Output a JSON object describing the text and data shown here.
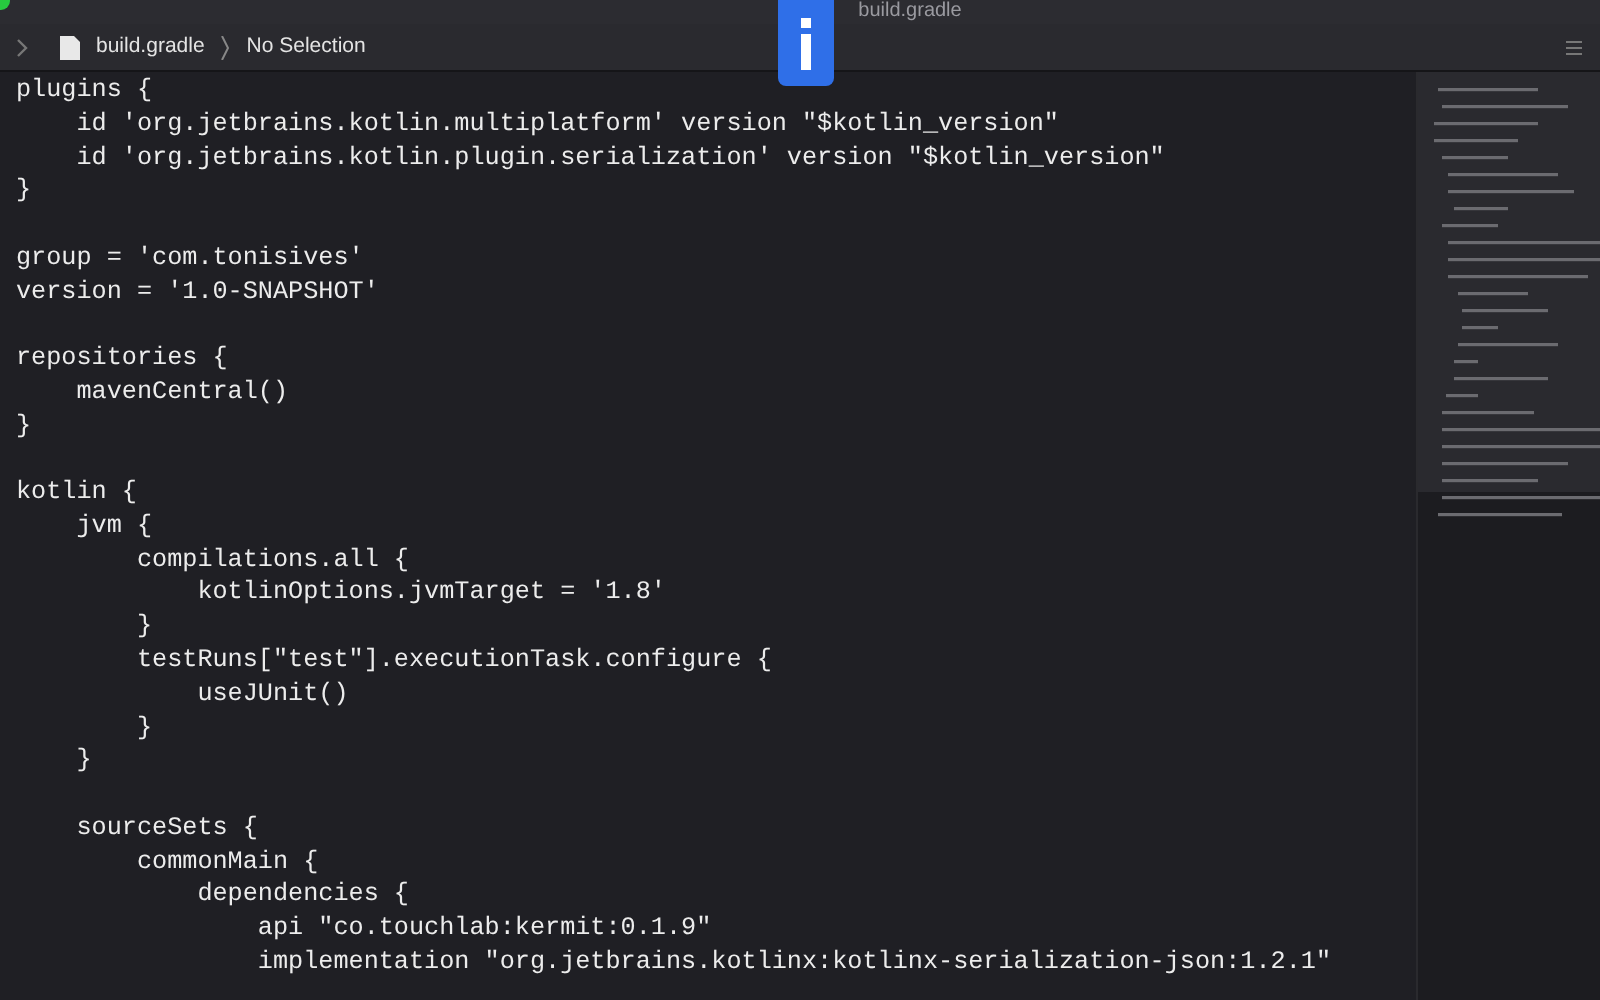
{
  "window": {
    "title": "build.gradle"
  },
  "jump_bar": {
    "file": "build.gradle",
    "selection": "No Selection"
  },
  "editor": {
    "blocks": [
      [
        "plugins {",
        "    id 'org.jetbrains.kotlin.multiplatform' version \"$kotlin_version\"",
        "    id 'org.jetbrains.kotlin.plugin.serialization' version \"$kotlin_version\"",
        "}"
      ],
      [
        "group = 'com.tonisives'",
        "version = '1.0-SNAPSHOT'"
      ],
      [
        "repositories {",
        "    mavenCentral()",
        "}"
      ],
      [
        "kotlin {",
        "    jvm {",
        "        compilations.all {",
        "            kotlinOptions.jvmTarget = '1.8'",
        "        }",
        "        testRuns[\"test\"].executionTask.configure {",
        "            useJUnit()",
        "        }",
        "    }"
      ],
      [
        "    sourceSets {",
        "        commonMain {",
        "            dependencies {",
        "                api \"co.touchlab:kermit:0.1.9\"",
        "                implementation \"org.jetbrains.kotlinx:kotlinx-serialization-json:1.2.1\""
      ]
    ]
  }
}
